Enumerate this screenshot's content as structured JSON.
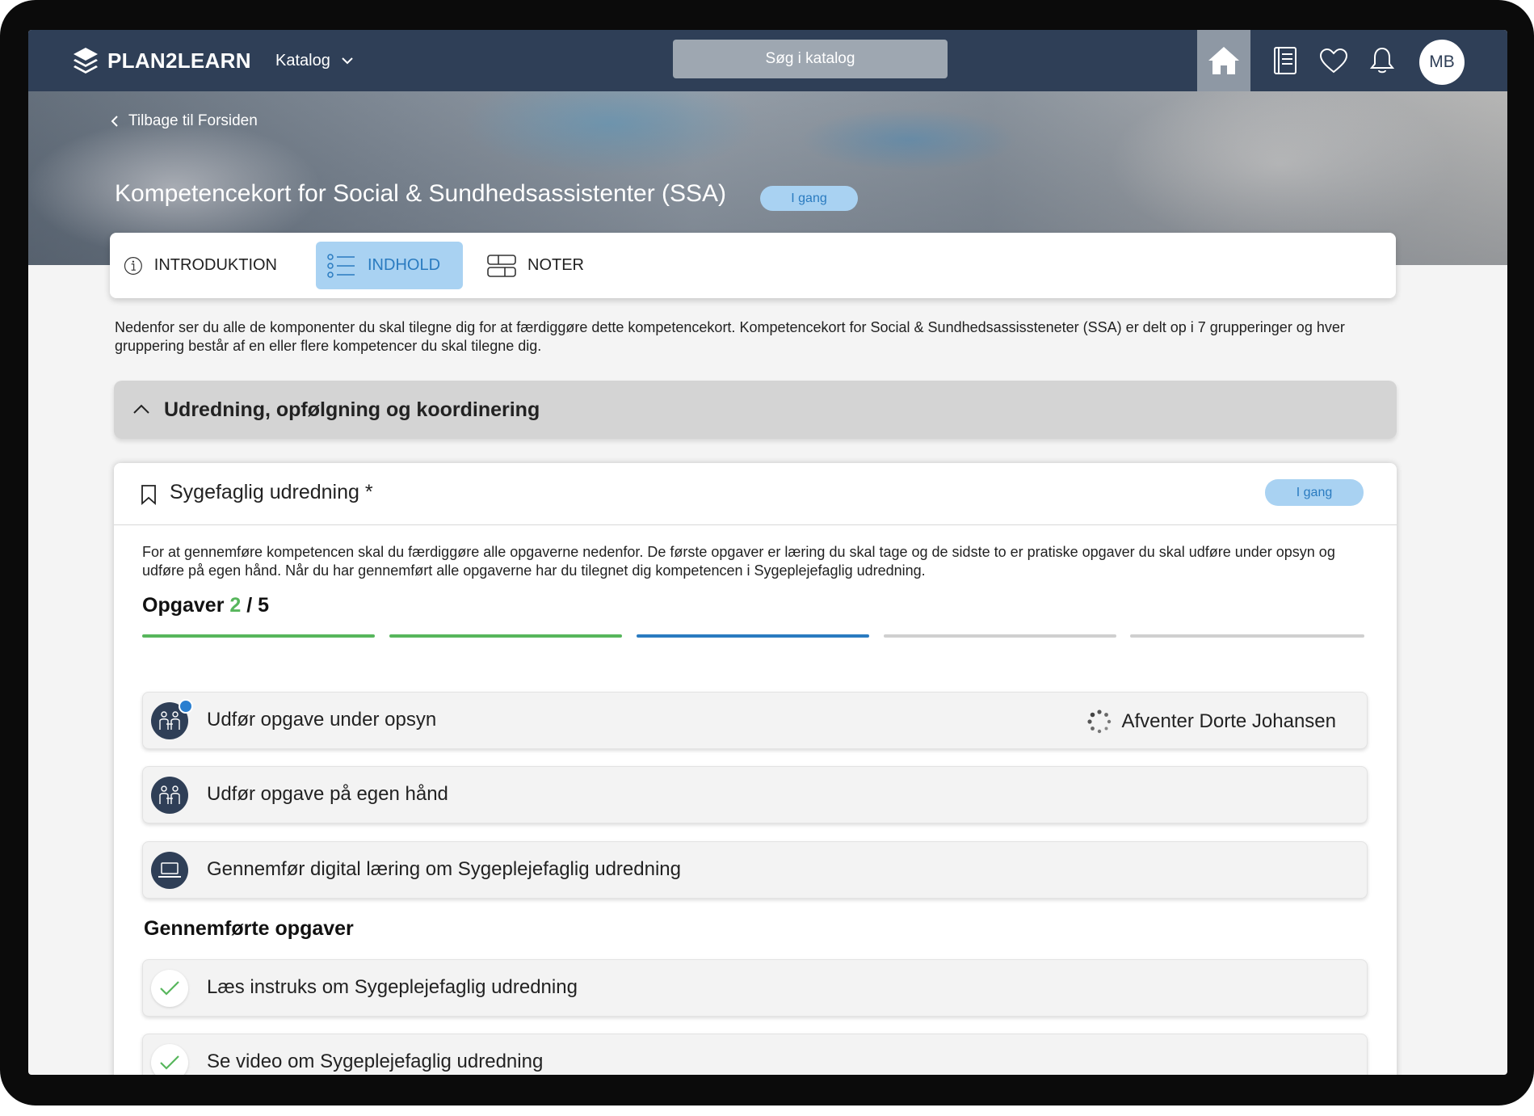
{
  "navbar": {
    "brand": "PLAN2LEARN",
    "catalog_label": "Katalog",
    "search_placeholder": "Søg i katalog",
    "avatar_initials": "MB"
  },
  "hero": {
    "back_label": "Tilbage til Forsiden",
    "title": "Kompetencekort for Social & Sundhedsassistenter (SSA)",
    "status_badge": "I gang"
  },
  "tabs": [
    {
      "label": "INTRODUKTION",
      "icon": "info-icon",
      "active": false
    },
    {
      "label": "INDHOLD",
      "icon": "list-icon",
      "active": true
    },
    {
      "label": "NOTER",
      "icon": "notes-icon",
      "active": false
    }
  ],
  "intro_text": "Nedenfor ser du alle de komponenter du skal tilegne dig for at færdiggøre dette kompetencekort. Kompetencekort for Social & Sundhedsassissteneter (SSA) er delt op i 7 grupperinger og hver gruppering består af en eller flere kompetencer du skal tilegne dig.",
  "group": {
    "title": "Udredning, opfølgning og koordinering"
  },
  "competence": {
    "title": "Sygefaglig udredning *",
    "status_badge": "I gang",
    "description": "For at gennemføre kompetencen skal du færdiggøre alle opgaverne nedenfor. De første opgaver er læring du skal tage og de sidste to er pratiske opgaver du skal udføre under opsyn og udføre på egen hånd. Når du har gennemført alle opgaverne har du tilegnet dig kompetencen i Sygeplejefaglig udredning.",
    "tasks_label": "Opgaver",
    "tasks_done": "2",
    "tasks_total": "/ 5",
    "progress": [
      "done",
      "done",
      "active",
      "todo",
      "todo"
    ],
    "open_tasks": [
      {
        "label": "Udfør opgave under opsyn",
        "icon": "people-icon",
        "status": "Afventer Dorte Johansen",
        "notification": true
      },
      {
        "label": "Udfør opgave på egen hånd",
        "icon": "people-icon",
        "status": ""
      },
      {
        "label": "Gennemfør digital læring om Sygeplejefaglig udredning",
        "icon": "laptop-icon",
        "status": ""
      }
    ],
    "completed_label": "Gennemførte opgaver",
    "completed_tasks": [
      {
        "label": "Læs instruks om Sygeplejefaglig udredning",
        "icon": "check-icon"
      },
      {
        "label": "Se video om Sygeplejefaglig udredning",
        "icon": "check-icon"
      }
    ]
  },
  "colors": {
    "navbar": "#2f3f57",
    "accent_blue": "#2a7bc0",
    "badge_bg": "#a9d2f2",
    "done_green": "#57b65c",
    "todo_gray": "#cfcfcf"
  }
}
